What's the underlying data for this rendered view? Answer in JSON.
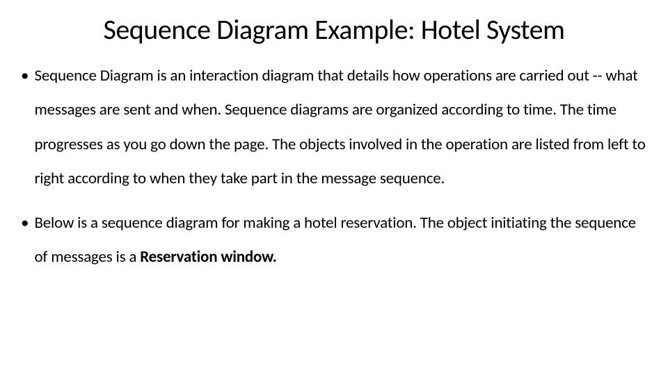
{
  "title": "Sequence Diagram Example: Hotel System",
  "bullets": [
    {
      "text": "Sequence Diagram is an interaction diagram that details how operations are carried out -- what messages are sent and when. Sequence diagrams are organized according to time. The time progresses as you go down the page. The objects involved in the operation are listed from left to right according to when they take part in the message sequence."
    },
    {
      "prefix": "Below is a sequence diagram for making a hotel reservation. The object initiating the sequence of messages is a ",
      "bold": "Reservation window.",
      "suffix": ""
    }
  ]
}
